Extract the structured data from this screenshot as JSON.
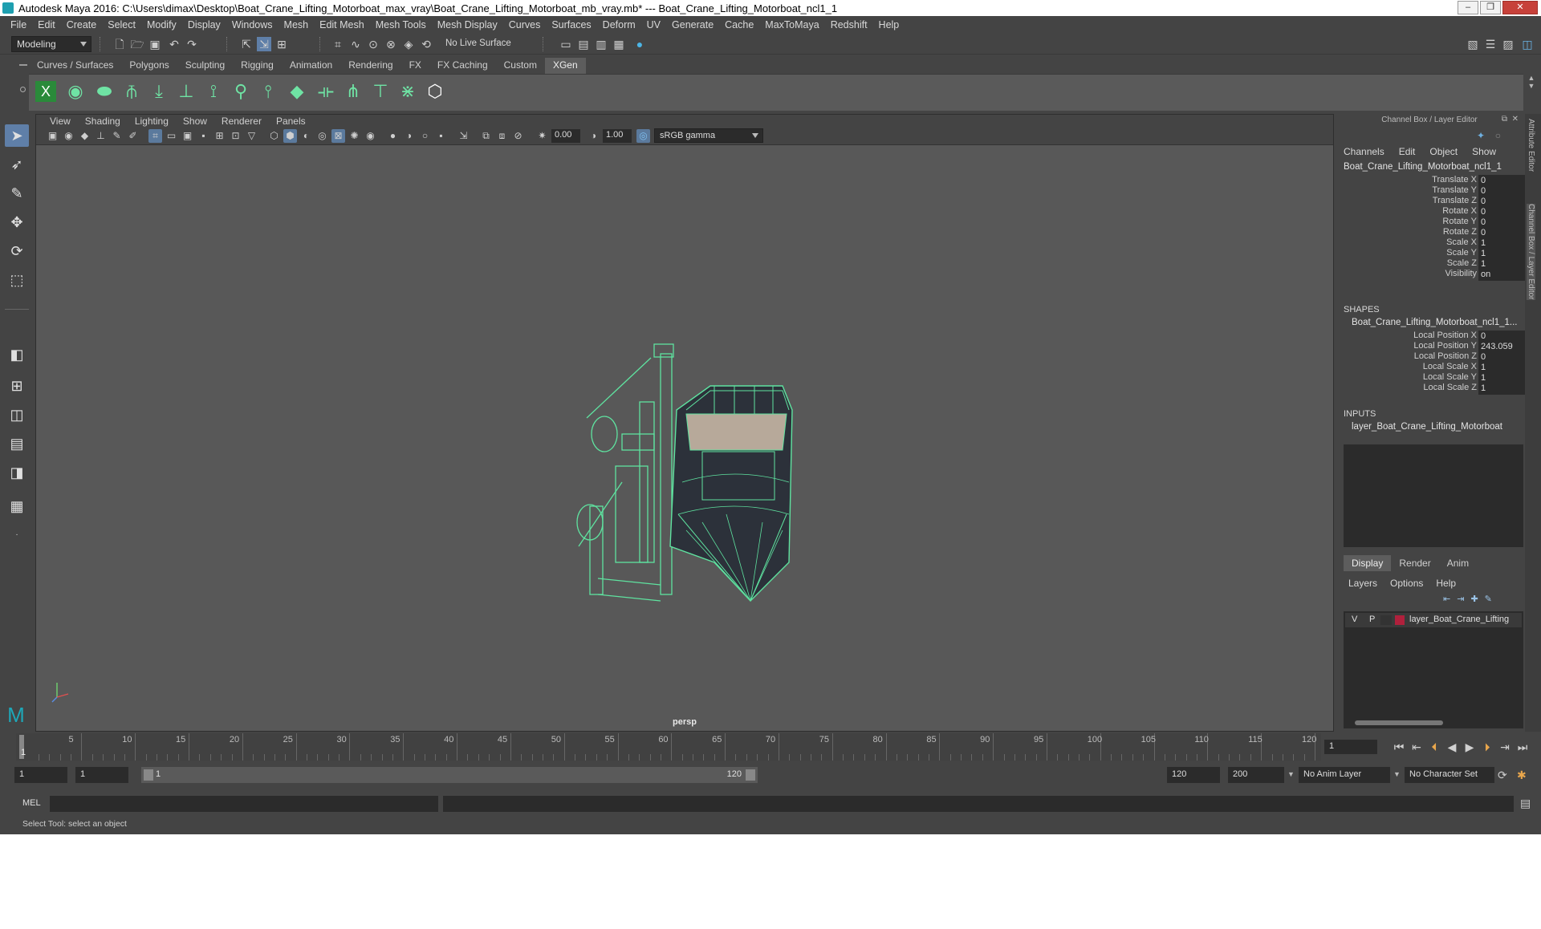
{
  "window": {
    "title": "Autodesk Maya 2016: C:\\Users\\dimax\\Desktop\\Boat_Crane_Lifting_Motorboat_max_vray\\Boat_Crane_Lifting_Motorboat_mb_vray.mb*   ---   Boat_Crane_Lifting_Motorboat_ncl1_1"
  },
  "menu": [
    "File",
    "Edit",
    "Create",
    "Select",
    "Modify",
    "Display",
    "Windows",
    "Mesh",
    "Edit Mesh",
    "Mesh Tools",
    "Mesh Display",
    "Curves",
    "Surfaces",
    "Deform",
    "UV",
    "Generate",
    "Cache",
    "MaxToMaya",
    "Redshift",
    "Help"
  ],
  "status": {
    "mode": "Modeling",
    "live_surface": "No Live Surface"
  },
  "shelf": {
    "tabs": [
      "Curves / Surfaces",
      "Polygons",
      "Sculpting",
      "Rigging",
      "Animation",
      "Rendering",
      "FX",
      "FX Caching",
      "Custom",
      "XGen"
    ],
    "active_tab": "XGen"
  },
  "viewport": {
    "menu": [
      "View",
      "Shading",
      "Lighting",
      "Show",
      "Renderer",
      "Panels"
    ],
    "exposure": "0.00",
    "gamma": "1.00",
    "color_space": "sRGB gamma",
    "camera_label": "persp"
  },
  "channel_box": {
    "header": "Channel Box / Layer Editor",
    "menu": [
      "Channels",
      "Edit",
      "Object",
      "Show"
    ],
    "object_name": "Boat_Crane_Lifting_Motorboat_ncl1_1",
    "channels": [
      {
        "label": "Translate X",
        "value": "0"
      },
      {
        "label": "Translate Y",
        "value": "0"
      },
      {
        "label": "Translate Z",
        "value": "0"
      },
      {
        "label": "Rotate X",
        "value": "0"
      },
      {
        "label": "Rotate Y",
        "value": "0"
      },
      {
        "label": "Rotate Z",
        "value": "0"
      },
      {
        "label": "Scale X",
        "value": "1"
      },
      {
        "label": "Scale Y",
        "value": "1"
      },
      {
        "label": "Scale Z",
        "value": "1"
      },
      {
        "label": "Visibility",
        "value": "on"
      }
    ],
    "shapes_header": "SHAPES",
    "shape_name": "Boat_Crane_Lifting_Motorboat_ncl1_1...",
    "shape_channels": [
      {
        "label": "Local Position X",
        "value": "0"
      },
      {
        "label": "Local Position Y",
        "value": "243.059"
      },
      {
        "label": "Local Position Z",
        "value": "0"
      },
      {
        "label": "Local Scale X",
        "value": "1"
      },
      {
        "label": "Local Scale Y",
        "value": "1"
      },
      {
        "label": "Local Scale Z",
        "value": "1"
      }
    ],
    "inputs_header": "INPUTS",
    "input_name": "layer_Boat_Crane_Lifting_Motorboat"
  },
  "layer_editor": {
    "tabs": [
      "Display",
      "Render",
      "Anim"
    ],
    "active_tab": "Display",
    "menu": [
      "Layers",
      "Options",
      "Help"
    ],
    "layer": {
      "v": "V",
      "p": "P",
      "name": "layer_Boat_Crane_Lifting",
      "color": "#b0203c"
    }
  },
  "side_tabs": [
    "Attribute Editor",
    "Channel Box / Layer Editor"
  ],
  "timeline": {
    "ticks": [
      "5",
      "10",
      "15",
      "20",
      "25",
      "30",
      "35",
      "40",
      "45",
      "50",
      "55",
      "60",
      "65",
      "70",
      "75",
      "80",
      "85",
      "90",
      "95",
      "100",
      "105",
      "110",
      "115",
      "120"
    ],
    "start_label": "1",
    "current_frame": "1"
  },
  "range": {
    "start": "1",
    "playback_start": "1",
    "slider_start": "1",
    "slider_end": "120",
    "playback_end": "120",
    "end": "200",
    "anim_layer": "No Anim Layer",
    "char_set": "No Character Set"
  },
  "command": {
    "label": "MEL"
  },
  "help_line": "Select Tool: select an object",
  "colors": {
    "wire": "#5fe3a0",
    "accent": "#5f7fa8"
  }
}
